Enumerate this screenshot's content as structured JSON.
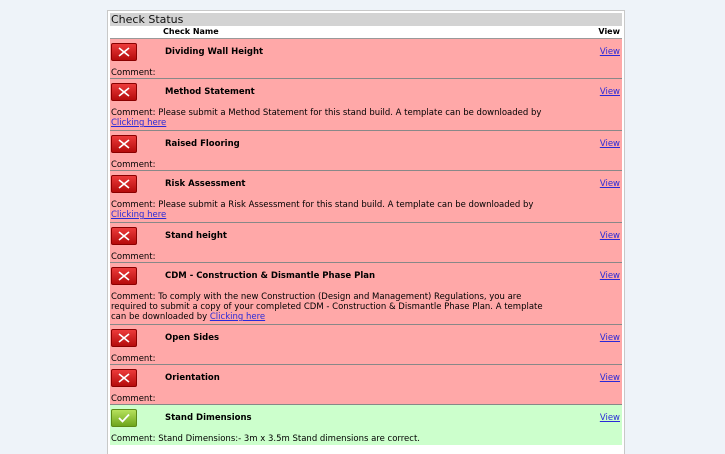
{
  "title": "Check Status",
  "columns": {
    "name": "Check Name",
    "view": "View"
  },
  "colors": {
    "fail": "#ffa8a8",
    "pass": "#ccffcc",
    "link": "#2a2ad8"
  },
  "rows": [
    {
      "status": "fail",
      "icon": "red-x-icon",
      "name": "Dividing Wall Height",
      "view": "View",
      "comment": "Comment:",
      "link": ""
    },
    {
      "status": "fail",
      "icon": "red-x-icon",
      "name": "Method Statement",
      "view": "View",
      "comment": "Comment: Please submit a Method Statement for this stand build. A template can be downloaded by",
      "link": "Clicking here"
    },
    {
      "status": "fail",
      "icon": "red-x-icon",
      "name": "Raised Flooring",
      "view": "View",
      "comment": "Comment:",
      "link": ""
    },
    {
      "status": "fail",
      "icon": "red-x-icon",
      "name": "Risk Assessment",
      "view": "View",
      "comment": "Comment: Please submit a Risk Assessment for this stand build. A template can be downloaded by",
      "link": "Clicking here"
    },
    {
      "status": "fail",
      "icon": "red-x-icon",
      "name": "Stand height",
      "view": "View",
      "comment": "Comment:",
      "link": ""
    },
    {
      "status": "fail",
      "icon": "red-x-icon",
      "name": "CDM - Construction & Dismantle Phase Plan",
      "view": "View",
      "comment": "Comment: To comply with the new Construction (Design and Management) Regulations, you are required to submit a copy of your completed CDM - Construction & Dismantle Phase Plan. A template can be downloaded by",
      "link": "Clicking here"
    },
    {
      "status": "fail",
      "icon": "red-x-icon",
      "name": "Open Sides",
      "view": "View",
      "comment": "Comment:",
      "link": ""
    },
    {
      "status": "fail",
      "icon": "red-x-icon",
      "name": "Orientation",
      "view": "View",
      "comment": "Comment:",
      "link": ""
    },
    {
      "status": "pass",
      "icon": "green-check-icon",
      "name": "Stand Dimensions",
      "view": "View",
      "comment": "Comment: Stand Dimensions:- 3m x 3.5m Stand dimensions are correct.",
      "link": ""
    }
  ]
}
